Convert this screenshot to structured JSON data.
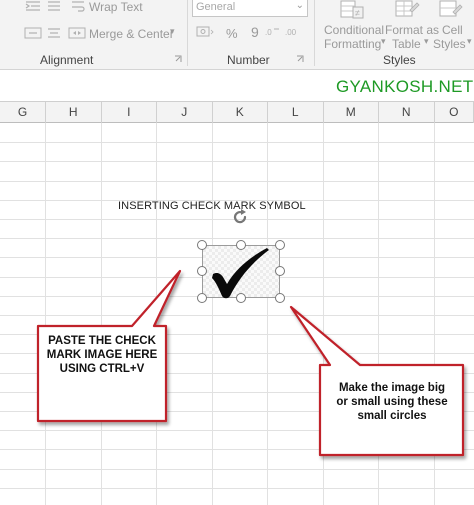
{
  "ribbon": {
    "alignment": {
      "wrap_text": "Wrap Text",
      "merge_center": "Merge & Center",
      "group_label": "Alignment"
    },
    "number": {
      "format_value": "General",
      "percent_symbol": "%",
      "comma_symbol": "9",
      "group_label": "Number"
    },
    "styles": {
      "conditional_formatting_line1": "Conditional",
      "conditional_formatting_line2": "Formatting",
      "format_as_table_line1": "Format as",
      "format_as_table_line2": "Table",
      "cell_styles_line1": "Cell",
      "cell_styles_line2": "Styles",
      "group_label": "Styles"
    }
  },
  "brand": "GYANKOSH.NET",
  "columns": [
    "G",
    "H",
    "I",
    "J",
    "K",
    "L",
    "M",
    "N",
    "O"
  ],
  "sheet": {
    "title": "INSERTING CHECK MARK SYMBOL"
  },
  "callouts": {
    "left": {
      "line1": "PASTE THE CHECK",
      "line2": "MARK IMAGE HERE",
      "line3": "USING CTRL+V"
    },
    "right": {
      "line1": "Make the image big",
      "line2": "or small using these",
      "line3": "small circles"
    }
  },
  "colors": {
    "brand_green": "#1e9a25",
    "callout_border": "#c0202a",
    "callout_fill": "#ffffff"
  },
  "icons": [
    "check-mark-icon",
    "rotate-icon",
    "indent-icon",
    "merge-icon",
    "currency-icon",
    "conditional-formatting-icon",
    "format-table-icon",
    "cell-styles-icon"
  ]
}
